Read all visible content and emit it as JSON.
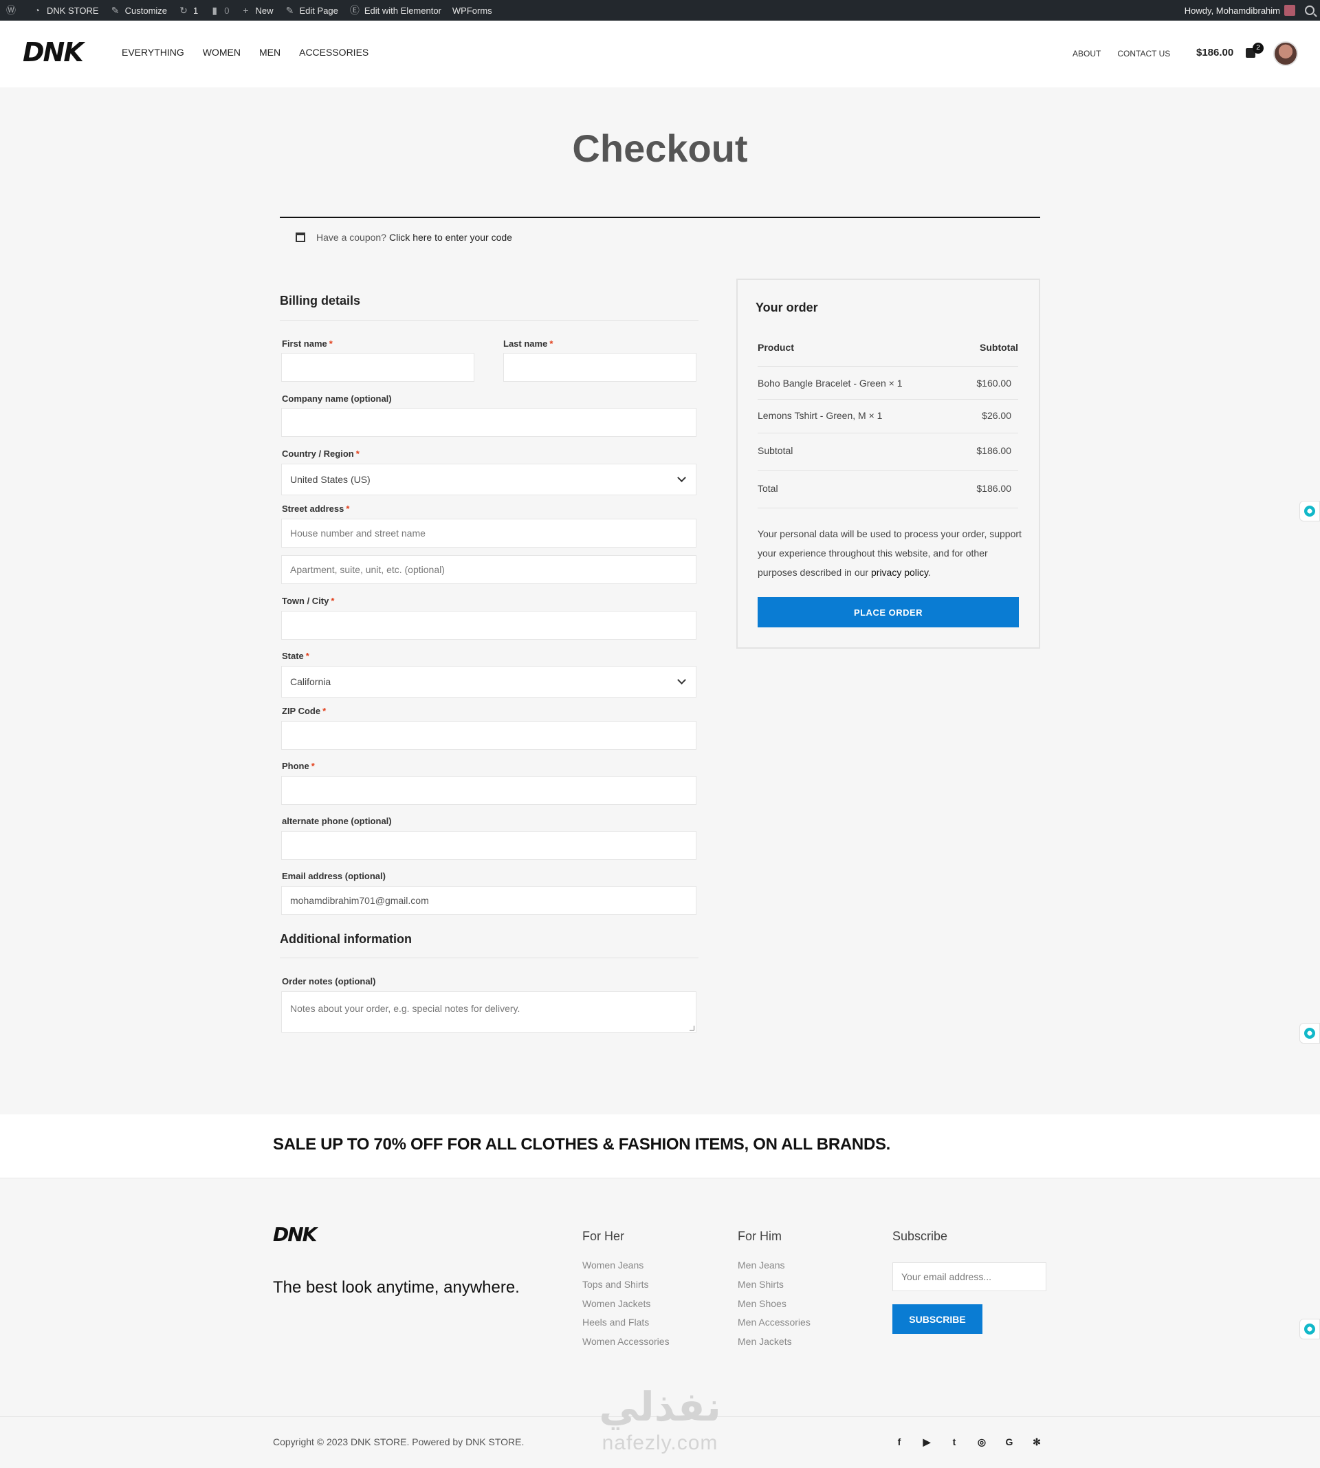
{
  "admin_bar": {
    "site_name": "DNK STORE",
    "customize": "Customize",
    "updates_count": "1",
    "comments_count": "0",
    "new": "New",
    "edit_page": "Edit Page",
    "edit_elementor": "Edit with Elementor",
    "wpforms": "WPForms",
    "howdy": "Howdy, Mohamdibrahim"
  },
  "header": {
    "logo": "DNK",
    "nav": [
      "EVERYTHING",
      "WOMEN",
      "MEN",
      "ACCESSORIES"
    ],
    "nav_right": [
      "ABOUT",
      "CONTACT US"
    ],
    "cart_total": "$186.00",
    "cart_count": "2"
  },
  "page": {
    "title": "Checkout",
    "coupon_text": "Have a coupon?",
    "coupon_link": "Click here to enter your code"
  },
  "billing": {
    "title": "Billing details",
    "first_name_label": "First name",
    "last_name_label": "Last name",
    "company_label": "Company name (optional)",
    "country_label": "Country / Region",
    "country_value": "United States (US)",
    "street_label": "Street address",
    "street_placeholder": "House number and street name",
    "apartment_placeholder": "Apartment, suite, unit, etc. (optional)",
    "city_label": "Town / City",
    "state_label": "State",
    "state_value": "California",
    "zip_label": "ZIP Code",
    "phone_label": "Phone",
    "alt_phone_label": "alternate phone (optional)",
    "email_label": "Email address (optional)",
    "email_value": "mohamdibrahim701@gmail.com",
    "required_mark": "*"
  },
  "additional": {
    "title": "Additional information",
    "notes_label": "Order notes (optional)",
    "notes_placeholder": "Notes about your order, e.g. special notes for delivery."
  },
  "order": {
    "title": "Your order",
    "col_product": "Product",
    "col_subtotal": "Subtotal",
    "items": [
      {
        "name": "Boho Bangle Bracelet - Green × 1",
        "price": "$160.00"
      },
      {
        "name": "Lemons Tshirt - Green, M × 1",
        "price": "$26.00"
      }
    ],
    "subtotal_label": "Subtotal",
    "subtotal_value": "$186.00",
    "total_label": "Total",
    "total_value": "$186.00",
    "privacy_text": "Your personal data will be used to process your order, support your experience throughout this website, and for other purposes described in our",
    "privacy_link": "privacy policy",
    "privacy_end": ".",
    "place_order": "PLACE ORDER"
  },
  "sale_banner": "SALE UP TO 70% OFF FOR ALL CLOTHES & FASHION ITEMS, ON ALL BRANDS.",
  "footer": {
    "logo": "DNK",
    "tagline": "The best look anytime, anywhere.",
    "for_her": {
      "title": "For Her",
      "links": [
        "Women Jeans",
        "Tops and Shirts",
        "Women Jackets",
        "Heels and Flats",
        "Women Accessories"
      ]
    },
    "for_him": {
      "title": "For Him",
      "links": [
        "Men Jeans",
        "Men Shirts",
        "Men Shoes",
        "Men Accessories",
        "Men Jackets"
      ]
    },
    "subscribe": {
      "title": "Subscribe",
      "placeholder": "Your email address...",
      "button": "SUBSCRIBE"
    },
    "copyright": "Copyright © 2023 DNK STORE. Powered by DNK STORE.",
    "socials": [
      "facebook-icon",
      "youtube-icon",
      "twitter-icon",
      "instagram-icon",
      "google-icon",
      "yelp-icon"
    ],
    "social_glyphs": [
      "f",
      "▶",
      "t",
      "◎",
      "G",
      "✻"
    ]
  },
  "watermark": {
    "arabic": "نفذلي",
    "latin": "nafezly.com"
  },
  "colors": {
    "accent": "#0a7cd3",
    "admin_bar": "#23282d",
    "required": "#e2401c"
  }
}
